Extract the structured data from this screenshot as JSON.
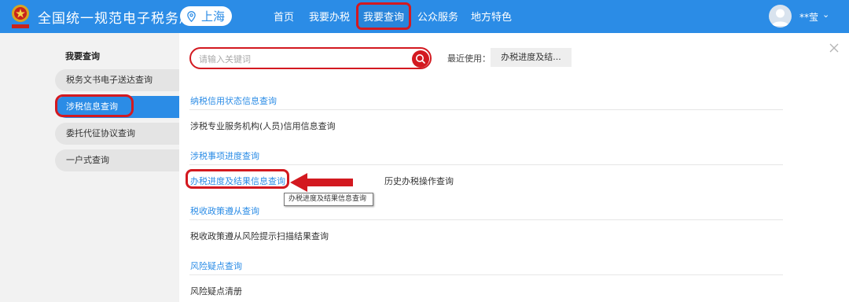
{
  "header": {
    "site_title": "全国统一规范电子税务局",
    "region": "上海",
    "nav": [
      "首页",
      "我要办税",
      "我要查询",
      "公众服务",
      "地方特色"
    ],
    "active_nav": "我要查询",
    "user_name": "**莹",
    "accent_color": "#2b8ce6",
    "highlight_color": "#d31920"
  },
  "sidebar": {
    "heading": "我要查询",
    "items": [
      "税务文书电子送达查询",
      "涉税信息查询",
      "委托代征协议查询",
      "一户式查询"
    ],
    "active": "涉税信息查询"
  },
  "main": {
    "search_placeholder": "请输入关键词",
    "recent_label": "最近使用：",
    "recent_chip": "办税进度及结...",
    "sections": [
      {
        "title": "纳税信用状态信息查询",
        "links": [
          "涉税专业服务机构(人员)信用信息查询"
        ]
      },
      {
        "title": "涉税事项进度查询",
        "links": [
          "办税进度及结果信息查询",
          "历史办税操作查询"
        ]
      },
      {
        "title": "税收政策遵从查询",
        "links": [
          "税收政策遵从风险提示扫描结果查询"
        ]
      },
      {
        "title": "风险疑点查询",
        "links": [
          "风险疑点清册"
        ]
      }
    ],
    "tooltip": "办税进度及结果信息查询"
  },
  "icons": {
    "emblem": "tax-emblem-icon",
    "region": "location-pin-icon",
    "search": "search-icon",
    "close": "close-icon",
    "user": "user-avatar-icon",
    "caret": "chevron-down-icon",
    "arrow": "red-arrow-icon"
  }
}
